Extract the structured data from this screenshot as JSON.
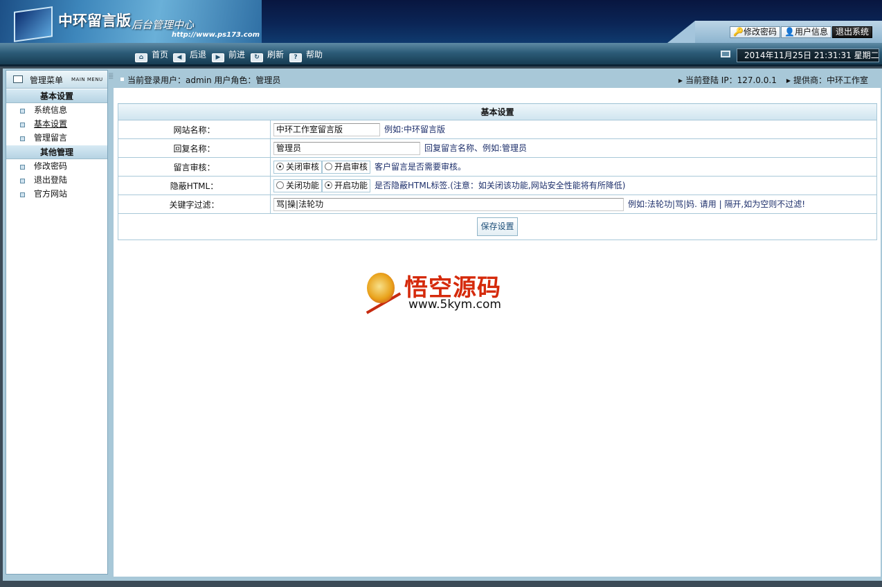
{
  "header": {
    "title": "中环留言版",
    "subtitle": "后台管理中心",
    "url": "http://www.ps173.com",
    "buttons": {
      "change_password": "修改密码",
      "user_info": "用户信息",
      "logout": "退出系统"
    }
  },
  "nav": {
    "items": [
      "首页",
      "后退",
      "前进",
      "刷新",
      "帮助"
    ],
    "datetime": "2014年11月25日 21:31:31 星期二"
  },
  "sidebar": {
    "title": "管理菜单",
    "title_en": "MAIN MENU",
    "groups": [
      {
        "name": "基本设置",
        "items": [
          "系统信息",
          "基本设置",
          "管理留言"
        ]
      },
      {
        "name": "其他管理",
        "items": [
          "修改密码",
          "退出登陆",
          "官方网站"
        ]
      }
    ]
  },
  "infobar": {
    "login_user": "当前登录用户：admin 用户角色：管理员",
    "login_ip": "当前登陆 IP：127.0.0.1",
    "provider": "提供商：中环工作室"
  },
  "settings": {
    "title": "基本设置",
    "site_name": {
      "label": "网站名称：",
      "value": "中环工作室留言版",
      "hint": "例如:中环留言版"
    },
    "reply_name": {
      "label": "回复名称：",
      "value": "管理员",
      "hint": "回复留言名称、例如:管理员"
    },
    "review": {
      "label": "留言审核：",
      "off": "关闭审核",
      "on": "开启审核",
      "selected": "off",
      "hint": "客户留言是否需要审核。"
    },
    "hide_html": {
      "label": "隐蔽HTML：",
      "off": "关闭功能",
      "on": "开启功能",
      "selected": "on",
      "hint": "是否隐蔽HTML标签.(注意：如关闭该功能,网站安全性能将有所降低)"
    },
    "keywords": {
      "label": "关键字过滤：",
      "value": "骂|操|法轮功",
      "hint": "例如:法轮功|骂|妈. 请用 | 隔开,如为空则不过滤!"
    },
    "save_label": "保存设置"
  },
  "watermark": {
    "text_cn": "悟空源码",
    "text_en": "www.5kym.com"
  }
}
